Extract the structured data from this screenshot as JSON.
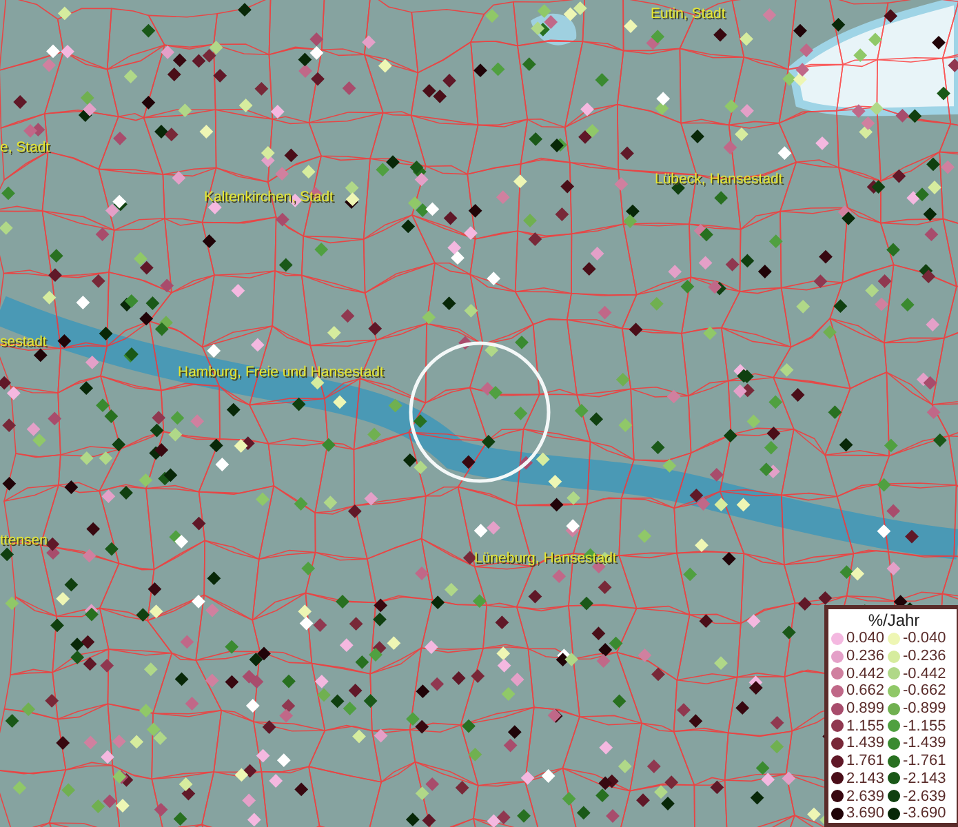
{
  "map": {
    "labels": [
      {
        "text": "Eutin, Stadt"
      },
      {
        "text": "e, Stadt"
      },
      {
        "text": "Lübeck, Hansestadt"
      },
      {
        "text": "Kaltenkirchen, Stadt"
      },
      {
        "text": "sestadt"
      },
      {
        "text": "Hamburg, Freie und Hansestadt"
      },
      {
        "text": "ttensen"
      },
      {
        "text": "Lüneburg, Hansestadt"
      }
    ]
  },
  "legend": {
    "title": "%/Jahr",
    "items": [
      {
        "value": "0.040",
        "color": "#f4b8e0"
      },
      {
        "value": "-0.040",
        "color": "#eef6b4"
      },
      {
        "value": "0.236",
        "color": "#e4a0c8"
      },
      {
        "value": "-0.236",
        "color": "#d6ec9e"
      },
      {
        "value": "0.442",
        "color": "#d0809f"
      },
      {
        "value": "-0.442",
        "color": "#b0d888"
      },
      {
        "value": "0.662",
        "color": "#c06888"
      },
      {
        "value": "-0.662",
        "color": "#90c868"
      },
      {
        "value": "0.899",
        "color": "#a84c6c"
      },
      {
        "value": "-0.899",
        "color": "#70b050"
      },
      {
        "value": "1.155",
        "color": "#903850"
      },
      {
        "value": "-1.155",
        "color": "#50a040"
      },
      {
        "value": "1.439",
        "color": "#782838"
      },
      {
        "value": "-1.439",
        "color": "#3a8a30"
      },
      {
        "value": "1.761",
        "color": "#601828"
      },
      {
        "value": "-1.761",
        "color": "#287020"
      },
      {
        "value": "2.143",
        "color": "#4a0e18"
      },
      {
        "value": "-2.143",
        "color": "#1a5818"
      },
      {
        "value": "2.639",
        "color": "#380810"
      },
      {
        "value": "-2.639",
        "color": "#104010"
      },
      {
        "value": "3.690",
        "color": "#200408"
      },
      {
        "value": "-3.690",
        "color": "#082808"
      }
    ]
  }
}
